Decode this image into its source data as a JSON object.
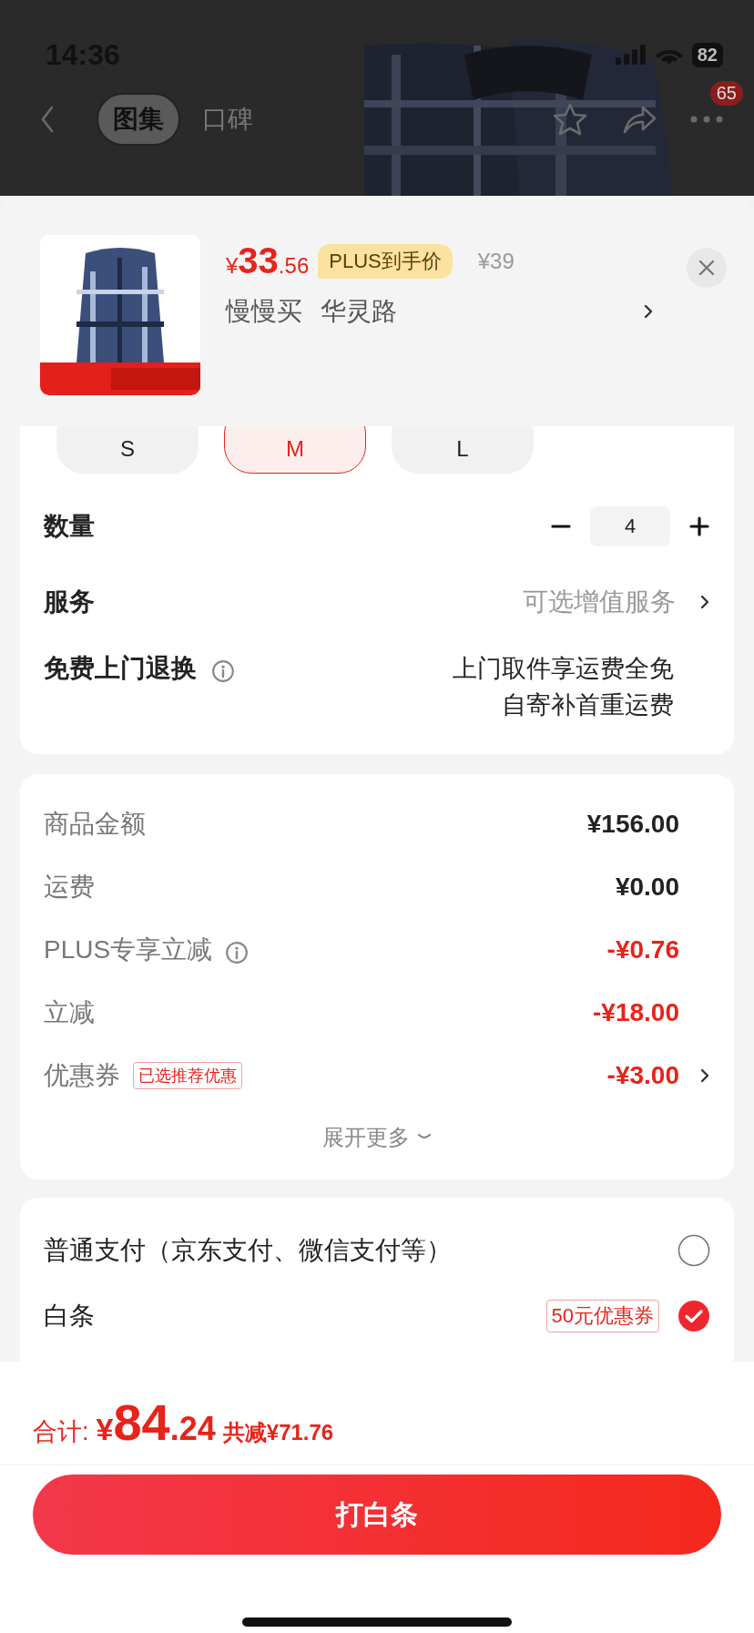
{
  "status_bar": {
    "time": "14:36",
    "battery": "82"
  },
  "nav": {
    "tabs": [
      {
        "label": "图集",
        "selected": true
      },
      {
        "label": "口碑",
        "selected": false
      }
    ],
    "badge": "65"
  },
  "product": {
    "currency": "¥",
    "price_int": "33",
    "price_dec": ".56",
    "tag": "PLUS到手价",
    "original_price": "¥39",
    "specs": [
      "慢慢买",
      "华灵路"
    ]
  },
  "sizes": [
    {
      "label": "S",
      "selected": false
    },
    {
      "label": "M",
      "selected": true
    },
    {
      "label": "L",
      "selected": false
    }
  ],
  "quantity": {
    "label": "数量",
    "value": "4"
  },
  "service": {
    "label": "服务",
    "value": "可选增值服务"
  },
  "return_service": {
    "label": "免费上门退换",
    "lines": [
      "上门取件享运费全免",
      "自寄补首重运费"
    ]
  },
  "price_rows": [
    {
      "label": "商品金额",
      "value": "¥156.00",
      "kind": "charge",
      "info": false,
      "chevron": false
    },
    {
      "label": "运费",
      "value": "¥0.00",
      "kind": "charge",
      "info": false,
      "chevron": false
    },
    {
      "label": "PLUS专享立减",
      "value": "-¥0.76",
      "kind": "discount",
      "info": true,
      "chevron": false
    },
    {
      "label": "立减",
      "value": "-¥18.00",
      "kind": "discount",
      "info": false,
      "chevron": false
    },
    {
      "label": "优惠券",
      "tag": "已选推荐优惠",
      "value": "-¥3.00",
      "kind": "discount",
      "info": false,
      "chevron": true
    }
  ],
  "expand": "展开更多",
  "payments": [
    {
      "label": "普通支付（京东支付、微信支付等）",
      "selected": false
    },
    {
      "label": "白条",
      "tag": "50元优惠券",
      "selected": true
    }
  ],
  "total": {
    "label": "合计:",
    "currency": "¥",
    "int": "84",
    "dec": ".24",
    "saved": "共减¥71.76"
  },
  "submit": "打白条"
}
